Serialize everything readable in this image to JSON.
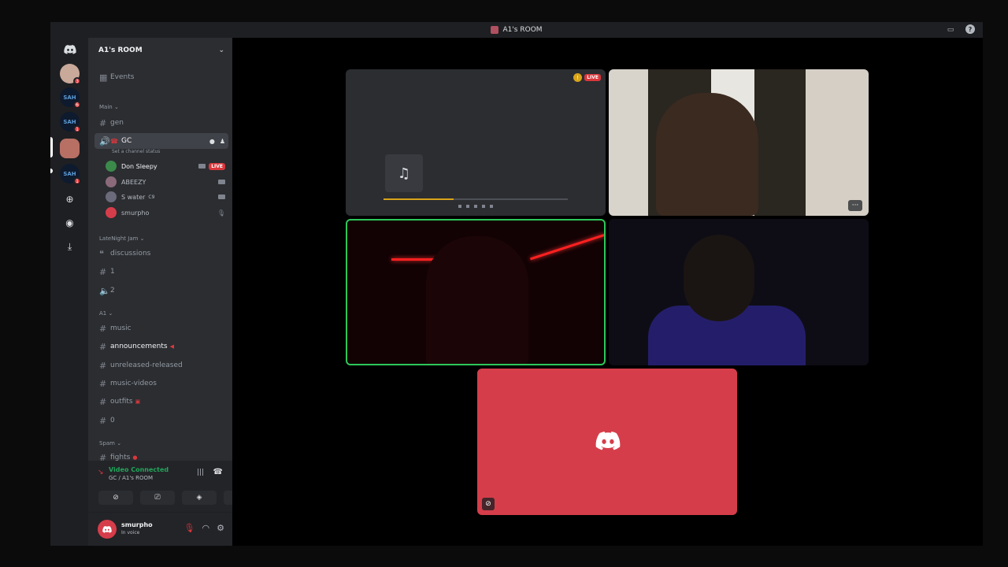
{
  "window": {
    "title": "A1's ROOM"
  },
  "server": {
    "name": "A1's ROOM"
  },
  "events_label": "Events",
  "categories": {
    "main": "Main",
    "late_night": "LateNight Jam",
    "a1": "A1",
    "spam": "Spam"
  },
  "channels": {
    "gen": "gen",
    "gc": "GC",
    "gc_status": "Set a channel status",
    "discussions": "discussions",
    "one": "1",
    "two": "2",
    "music": "music",
    "announcements": "announcements",
    "unreleased": "unreleased-released",
    "music_videos": "music-videos",
    "outfits": "outfits",
    "zero": "0",
    "fights": "fights"
  },
  "voice_users": [
    {
      "name": "Don Sleepy",
      "badge": "LIVE",
      "color": "#3b8a4a"
    },
    {
      "name": "ABEEZY",
      "color": "#8a6a7a"
    },
    {
      "name": "S water",
      "tag": "C9",
      "color": "#6a6a7a"
    },
    {
      "name": "smurpho",
      "color": "#d63d4a"
    }
  ],
  "servers": [
    {
      "color": "#c9a99a",
      "badge": "3"
    },
    {
      "color": "#0e1a2e",
      "text": "SAH",
      "badge": "6"
    },
    {
      "color": "#0e1a2e",
      "text": "SAH",
      "badge": "1"
    },
    {
      "color": "#b87064"
    },
    {
      "color": "#0e1a2e",
      "text": "SAH",
      "badge": "1"
    }
  ],
  "voice_panel": {
    "status": "Video Connected",
    "channel": "GC / A1's ROOM"
  },
  "user": {
    "name": "smurpho",
    "status": "In voice"
  },
  "stream": {
    "live_label": "LIVE"
  },
  "icons": {
    "discord": "discord-icon",
    "hash": "hashtag-icon",
    "speaker": "speaker-icon"
  }
}
